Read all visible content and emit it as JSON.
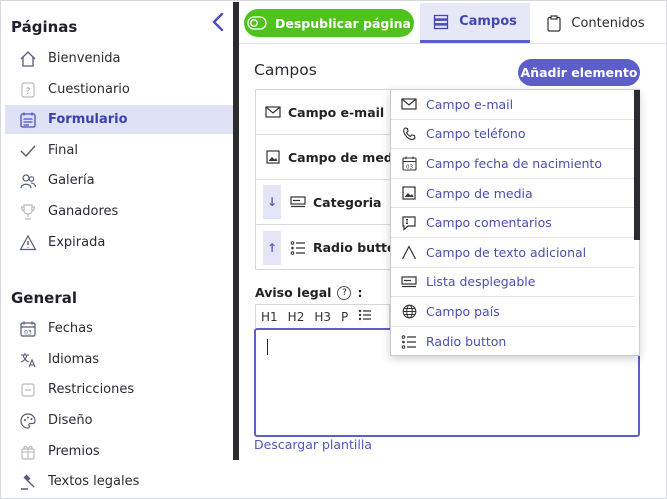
{
  "sidebar": {
    "section_pages": "Páginas",
    "pages": [
      {
        "label": "Bienvenida",
        "icon": "home-icon"
      },
      {
        "label": "Cuestionario",
        "icon": "question-icon"
      },
      {
        "label": "Formulario",
        "icon": "calendar-form-icon",
        "active": true
      },
      {
        "label": "Final",
        "icon": "check-icon"
      },
      {
        "label": "Galería",
        "icon": "people-icon"
      },
      {
        "label": "Ganadores",
        "icon": "trophy-icon"
      },
      {
        "label": "Expirada",
        "icon": "warning-icon"
      }
    ],
    "section_general": "General",
    "general": [
      {
        "label": "Fechas",
        "icon": "calendar-icon"
      },
      {
        "label": "Idiomas",
        "icon": "translate-icon"
      },
      {
        "label": "Restricciones",
        "icon": "restriction-icon"
      },
      {
        "label": "Diseño",
        "icon": "palette-icon"
      },
      {
        "label": "Premios",
        "icon": "prize-icon"
      },
      {
        "label": "Textos legales",
        "icon": "gavel-icon"
      }
    ]
  },
  "topbar": {
    "unpublish_label": "Despublicar página",
    "tab_campos": "Campos",
    "tab_contenidos": "Contenidos"
  },
  "main": {
    "title": "Campos",
    "add_button": "Añadir elemento",
    "fields": [
      {
        "label": "Campo e-mail",
        "icon": "mail-icon"
      },
      {
        "label": "Campo de media",
        "icon": "image-icon"
      },
      {
        "label": "Categoria",
        "icon": "select-icon",
        "arrow": "↓"
      },
      {
        "label": "Radio button",
        "icon": "list-icon",
        "arrow": "↑"
      }
    ],
    "legal_label": "Aviso legal",
    "legal_colon": ":",
    "toolbar": [
      "H1",
      "H2",
      "H3",
      "P"
    ],
    "download_link": "Descargar plantilla"
  },
  "dropdown": {
    "items": [
      {
        "label": "Campo e-mail",
        "icon": "mail-icon"
      },
      {
        "label": "Campo teléfono",
        "icon": "phone-icon"
      },
      {
        "label": "Campo fecha de nacimiento",
        "icon": "calendar-icon"
      },
      {
        "label": "Campo de media",
        "icon": "image-icon"
      },
      {
        "label": "Campo comentarios",
        "icon": "comment-icon"
      },
      {
        "label": "Campo de texto adicional",
        "icon": "text-icon"
      },
      {
        "label": "Lista desplegable",
        "icon": "select-icon"
      },
      {
        "label": "Campo país",
        "icon": "globe-icon"
      },
      {
        "label": "Radio button",
        "icon": "list-icon"
      }
    ]
  },
  "colors": {
    "accent": "#5b5fc7",
    "success": "#4fc21d",
    "active_bg": "#dfe1f6"
  }
}
